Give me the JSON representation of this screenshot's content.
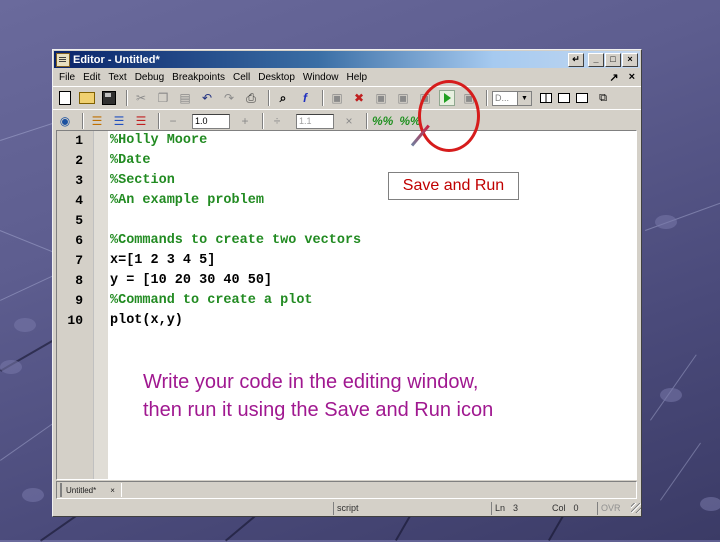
{
  "window": {
    "title": "Editor - Untitled*",
    "controls": [
      "undock",
      "minimize",
      "maximize",
      "close"
    ]
  },
  "menubar": {
    "items": [
      "File",
      "Edit",
      "Text",
      "Debug",
      "Breakpoints",
      "Cell",
      "Desktop",
      "Window",
      "Help"
    ],
    "right_icons": [
      "undock-arrow",
      "close-x"
    ]
  },
  "toolbar": {
    "stack_combo_value": "D...",
    "icons": [
      "new-file",
      "open-folder",
      "save",
      "cut",
      "copy",
      "paste",
      "undo",
      "redo",
      "print",
      "find",
      "function",
      "set-breakpoint",
      "clear-breakpoints",
      "step-in",
      "step-out",
      "stop",
      "save-and-run",
      "exit-debug"
    ]
  },
  "cell_toolbar": {
    "minus_label": "−",
    "plus_label": "+",
    "increment_value": "1.0",
    "divide_label": "÷",
    "divisor_value": "1.1",
    "times_label": "×"
  },
  "editor": {
    "lines": [
      {
        "n": "1",
        "text": "%Holly Moore",
        "type": "comment"
      },
      {
        "n": "2",
        "text": "%Date",
        "type": "comment"
      },
      {
        "n": "3",
        "text": "%Section",
        "type": "comment"
      },
      {
        "n": "4",
        "text": "%An example problem",
        "type": "comment"
      },
      {
        "n": "5",
        "text": "",
        "type": "code"
      },
      {
        "n": "6",
        "text": "%Commands to create two vectors",
        "type": "comment"
      },
      {
        "n": "7",
        "text": "x=[1 2 3 4 5]",
        "type": "code"
      },
      {
        "n": "8",
        "text": "y = [10 20 30 40 50]",
        "type": "code"
      },
      {
        "n": "9",
        "text": "%Command to create a plot",
        "type": "comment"
      },
      {
        "n": "10",
        "text": "plot(x,y)",
        "type": "code"
      }
    ]
  },
  "tabs": [
    {
      "label": "Untitled*",
      "close": "×"
    }
  ],
  "statusbar": {
    "mode": "script",
    "ln_label": "Ln",
    "ln_value": "3",
    "col_label": "Col",
    "col_value": "0",
    "ovr": "OVR"
  },
  "annotation": {
    "callout": "Save and Run",
    "caption_line1": "Write your code in the editing window,",
    "caption_line2": "then run it using the Save and Run icon",
    "callout_color": "#c00000",
    "circle_color": "#d61c1c",
    "caption_color": "#a01890"
  }
}
